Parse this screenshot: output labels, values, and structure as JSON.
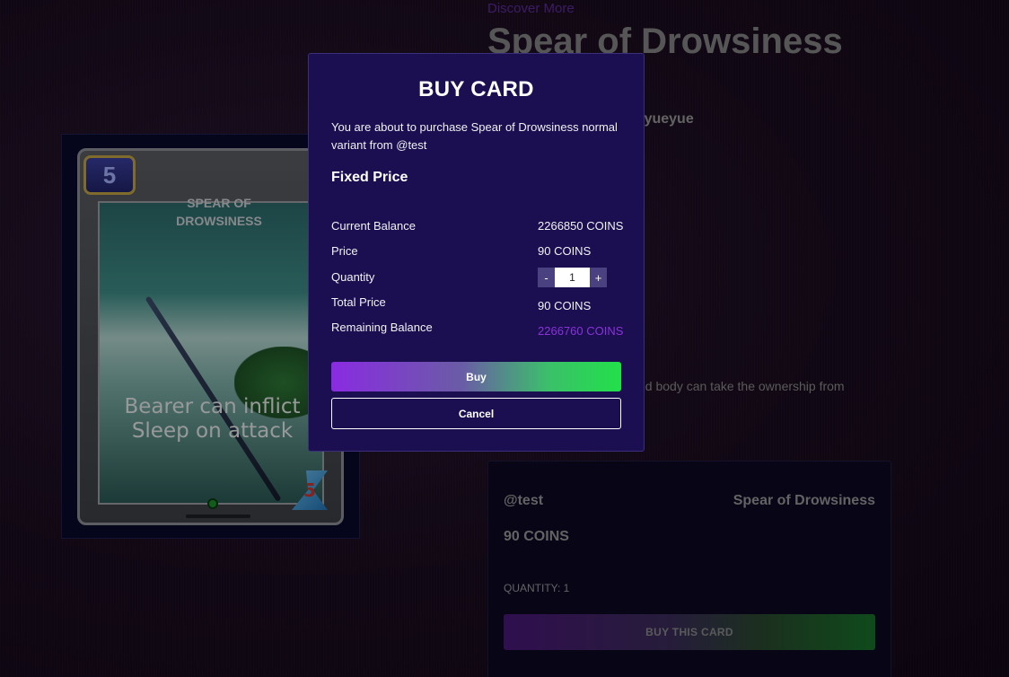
{
  "page": {
    "discover_link": "Discover More",
    "title": "Spear of Drowsiness",
    "team_partial": "am yueyue",
    "description_partial": "alized body can take the ownership from"
  },
  "card": {
    "mana": "5",
    "name": "SPEAR OF DROWSINESS",
    "ability_text": "Bearer can inflict Sleep on attack",
    "attack": "5"
  },
  "listing": {
    "seller": "@test",
    "card_name": "Spear of Drowsiness",
    "price": "90 COINS",
    "quantity": "QUANTITY: 1",
    "buy_button": "BUY THIS CARD"
  },
  "modal": {
    "title": "BUY CARD",
    "intro": "You are about to purchase Spear of Drowsiness normal variant from @test",
    "section": "Fixed Price",
    "rows": [
      {
        "label": "Current Balance",
        "value": "2266850 COINS"
      },
      {
        "label": "Price",
        "value": "90 COINS"
      },
      {
        "label": "Quantity",
        "value": "1"
      },
      {
        "label": "Total Price",
        "value": "90 COINS"
      },
      {
        "label": "Remaining Balance",
        "value": "2266760 COINS"
      }
    ],
    "minus": "-",
    "plus": "+",
    "buy": "Buy",
    "cancel": "Cancel"
  },
  "colors": {
    "modal_bg": "#1b0f52",
    "accent_purple": "#8a33d9",
    "buy_gradient_start": "#8a2be2",
    "buy_gradient_end": "#22e04a"
  }
}
